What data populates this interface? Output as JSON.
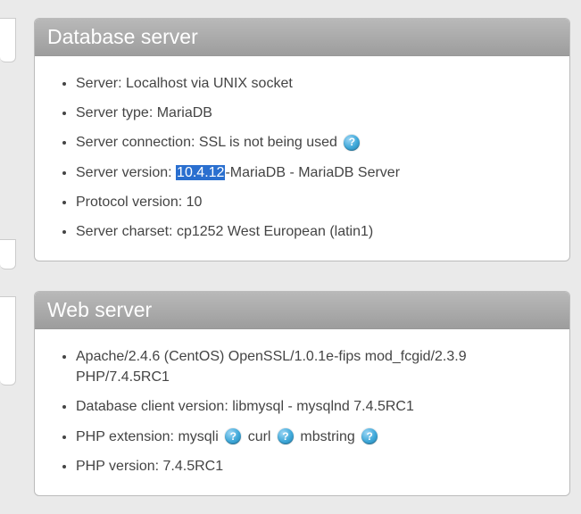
{
  "panels": {
    "db": {
      "title": "Database server",
      "items": {
        "server_label": "Server:",
        "server_value": "Localhost via UNIX socket",
        "server_type_label": "Server type:",
        "server_type_value": "MariaDB",
        "server_conn_label": "Server connection:",
        "server_conn_value": "SSL is not being used",
        "server_version_label": "Server version:",
        "server_version_highlight": "10.4.12",
        "server_version_suffix": "-MariaDB - MariaDB Server",
        "protocol_label": "Protocol version:",
        "protocol_value": "10",
        "charset_label": "Server charset:",
        "charset_value": "cp1252 West European (latin1)"
      }
    },
    "web": {
      "title": "Web server",
      "items": {
        "apache": "Apache/2.4.6 (CentOS) OpenSSL/1.0.1e-fips mod_fcgid/2.3.9 PHP/7.4.5RC1",
        "db_client_label": "Database client version:",
        "db_client_value": "libmysql - mysqlnd 7.4.5RC1",
        "php_ext_label": "PHP extension:",
        "php_ext_1": "mysqli",
        "php_ext_2": "curl",
        "php_ext_3": "mbstring",
        "php_ver_label": "PHP version:",
        "php_ver_value": "7.4.5RC1"
      }
    }
  },
  "help_glyph": "?"
}
